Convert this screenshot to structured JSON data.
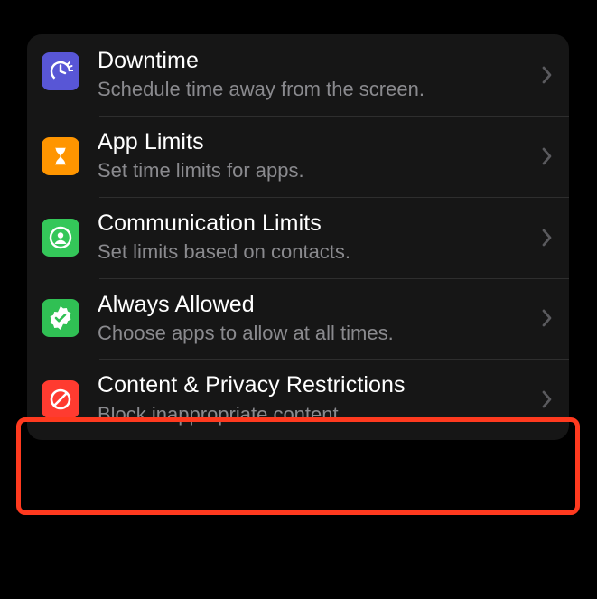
{
  "items": [
    {
      "title": "Downtime",
      "subtitle": "Schedule time away from the screen.",
      "icon": "downtime-clock-icon",
      "tile_color": "#5856d6"
    },
    {
      "title": "App Limits",
      "subtitle": "Set time limits for apps.",
      "icon": "hourglass-icon",
      "tile_color": "#ff9500"
    },
    {
      "title": "Communication Limits",
      "subtitle": "Set limits based on contacts.",
      "icon": "contact-circle-icon",
      "tile_color": "#34c759"
    },
    {
      "title": "Always Allowed",
      "subtitle": "Choose apps to allow at all times.",
      "icon": "seal-check-icon",
      "tile_color": "#30c054"
    },
    {
      "title": "Content & Privacy Restrictions",
      "subtitle": "Block inappropriate content.",
      "icon": "no-symbol-icon",
      "tile_color": "#ff3b30"
    }
  ],
  "highlighted_index": 4
}
